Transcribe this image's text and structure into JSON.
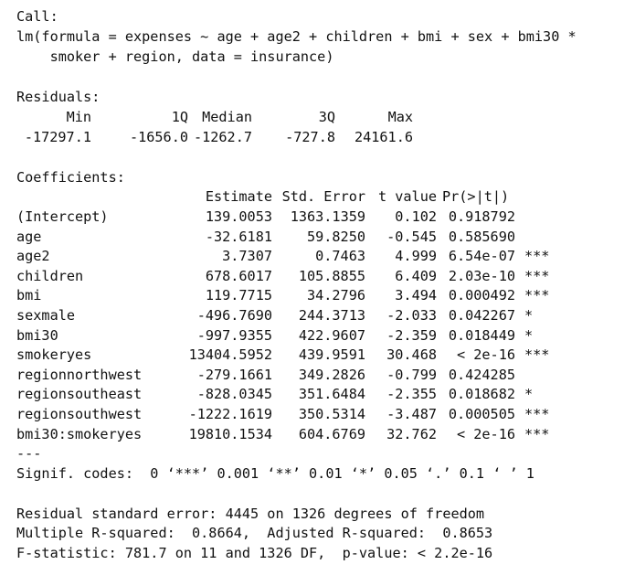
{
  "call": {
    "header": "Call:",
    "formula_line1": "lm(formula = expenses ~ age + age2 + children + bmi + sex + bmi30 *",
    "formula_line2": "    smoker + region, data = insurance)"
  },
  "residuals": {
    "header": "Residuals:",
    "labels": [
      "Min",
      "1Q",
      "Median",
      "3Q",
      "Max"
    ],
    "values": [
      "-17297.1",
      "-1656.0",
      "-1262.7",
      "-727.8",
      "24161.6"
    ]
  },
  "coefficients": {
    "header": "Coefficients:",
    "columns": [
      "Estimate",
      "Std. Error",
      "t value",
      "Pr(>|t|)"
    ],
    "rows": [
      {
        "term": "(Intercept)",
        "estimate": "139.0053",
        "std_error": "1363.1359",
        "t_value": "0.102",
        "p_value": "0.918792",
        "signif": ""
      },
      {
        "term": "age",
        "estimate": "-32.6181",
        "std_error": "59.8250",
        "t_value": "-0.545",
        "p_value": "0.585690",
        "signif": ""
      },
      {
        "term": "age2",
        "estimate": "3.7307",
        "std_error": "0.7463",
        "t_value": "4.999",
        "p_value": "6.54e-07",
        "signif": "***"
      },
      {
        "term": "children",
        "estimate": "678.6017",
        "std_error": "105.8855",
        "t_value": "6.409",
        "p_value": "2.03e-10",
        "signif": "***"
      },
      {
        "term": "bmi",
        "estimate": "119.7715",
        "std_error": "34.2796",
        "t_value": "3.494",
        "p_value": "0.000492",
        "signif": "***"
      },
      {
        "term": "sexmale",
        "estimate": "-496.7690",
        "std_error": "244.3713",
        "t_value": "-2.033",
        "p_value": "0.042267",
        "signif": "*"
      },
      {
        "term": "bmi30",
        "estimate": "-997.9355",
        "std_error": "422.9607",
        "t_value": "-2.359",
        "p_value": "0.018449",
        "signif": "*"
      },
      {
        "term": "smokeryes",
        "estimate": "13404.5952",
        "std_error": "439.9591",
        "t_value": "30.468",
        "p_value": "< 2e-16",
        "signif": "***"
      },
      {
        "term": "regionnorthwest",
        "estimate": "-279.1661",
        "std_error": "349.2826",
        "t_value": "-0.799",
        "p_value": "0.424285",
        "signif": ""
      },
      {
        "term": "regionsoutheast",
        "estimate": "-828.0345",
        "std_error": "351.6484",
        "t_value": "-2.355",
        "p_value": "0.018682",
        "signif": "*"
      },
      {
        "term": "regionsouthwest",
        "estimate": "-1222.1619",
        "std_error": "350.5314",
        "t_value": "-3.487",
        "p_value": "0.000505",
        "signif": "***"
      },
      {
        "term": "bmi30:smokeryes",
        "estimate": "19810.1534",
        "std_error": "604.6769",
        "t_value": "32.762",
        "p_value": "< 2e-16",
        "signif": "***"
      }
    ],
    "separator": "---",
    "signif_codes": "Signif. codes:  0 ‘***’ 0.001 ‘**’ 0.01 ‘*’ 0.05 ‘.’ 0.1 ‘ ’ 1"
  },
  "summary": {
    "residual_se": "Residual standard error: 4445 on 1326 degrees of freedom",
    "r_squared": "Multiple R-squared:  0.8664,\tAdjusted R-squared:  0.8653",
    "f_statistic": "F-statistic: 781.7 on 11 and 1326 DF,  p-value: < 2.2e-16"
  }
}
